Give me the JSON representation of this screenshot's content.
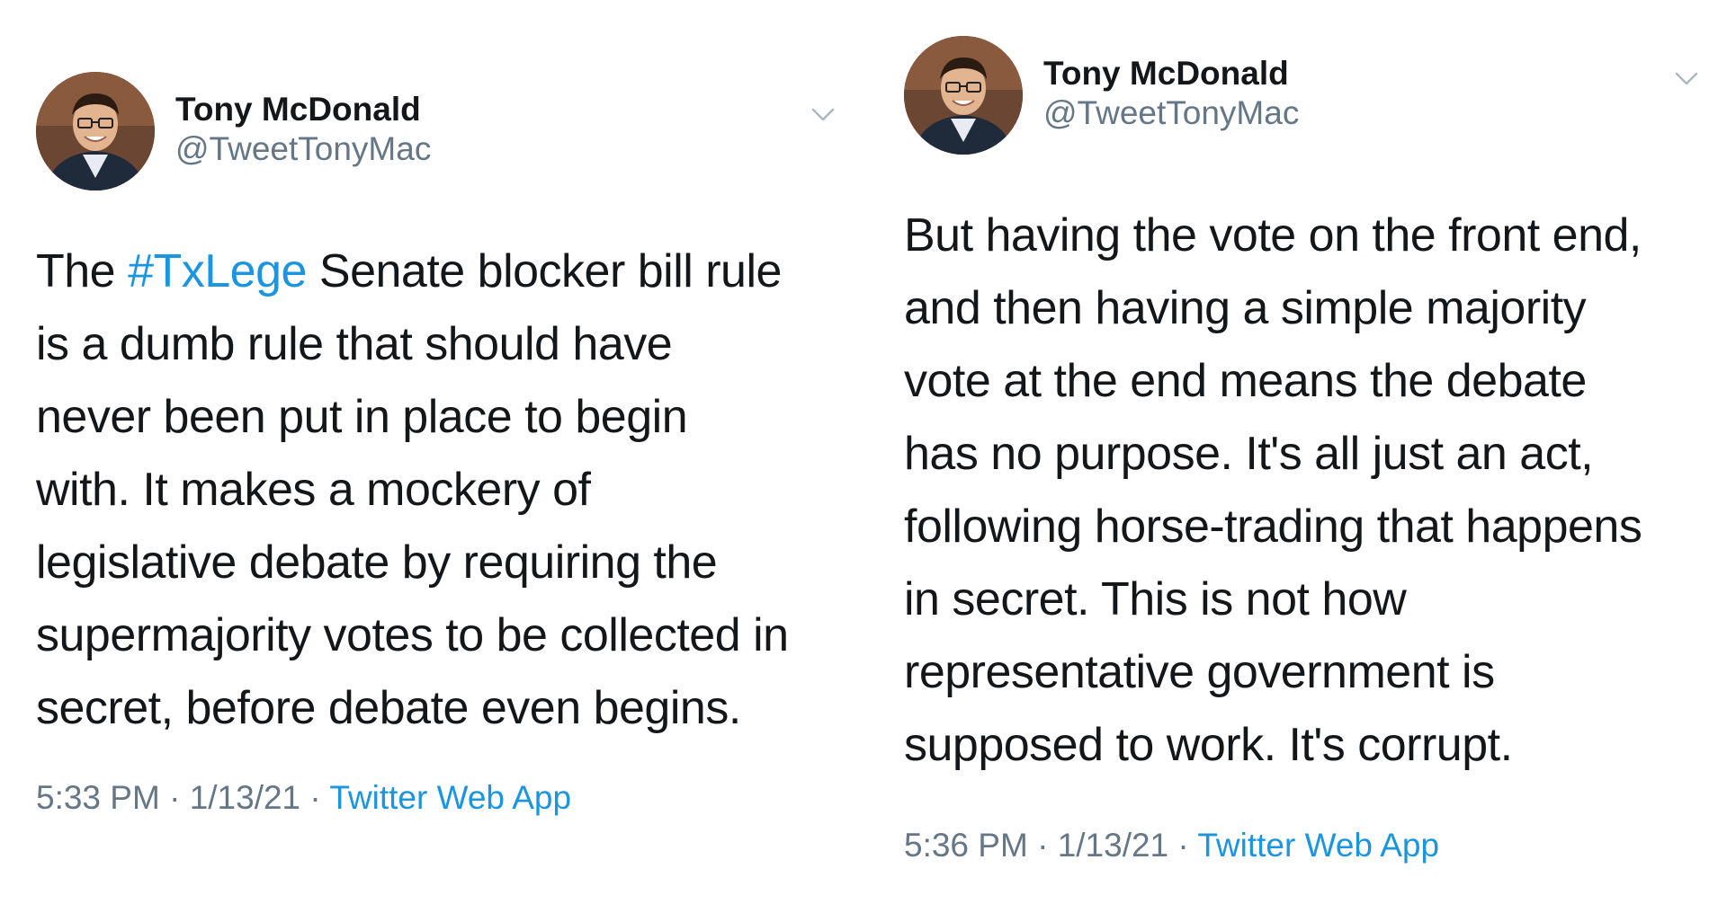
{
  "tweets": [
    {
      "display_name": "Tony McDonald",
      "handle": "@TweetTonyMac",
      "text_lines": [
        {
          "before": "The ",
          "hashtag": "#TxLege",
          "after": " Senate blocker bill rule"
        },
        {
          "text": "is a dumb rule that should have"
        },
        {
          "text": "never been put in place to begin"
        },
        {
          "text": "with. It makes a mockery of"
        },
        {
          "text": "legislative debate by requiring the"
        },
        {
          "text": "supermajority votes to be collected in"
        },
        {
          "text": "secret, before debate even begins."
        }
      ],
      "time": "5:33 PM",
      "separator": " · ",
      "date": "1/13/21",
      "source": "Twitter Web App"
    },
    {
      "display_name": "Tony McDonald",
      "handle": "@TweetTonyMac",
      "text_lines": [
        {
          "text": "But having the vote on the front end,"
        },
        {
          "text": "and then having a simple majority"
        },
        {
          "text": "vote at the end means the debate"
        },
        {
          "text": "has no purpose. It's all just an act,"
        },
        {
          "text": "following horse-trading that happens"
        },
        {
          "text": "in secret. This is not how"
        },
        {
          "text": "representative government is"
        },
        {
          "text": "supposed to work. It's corrupt."
        }
      ],
      "time": "5:36 PM",
      "separator": " · ",
      "date": "1/13/21",
      "source": "Twitter Web App"
    }
  ],
  "icons": {
    "menu": "chevron-down-icon",
    "avatar": "profile-photo"
  },
  "colors": {
    "link": "#1b95e0",
    "secondary_text": "#657786",
    "primary_text": "#14171a"
  }
}
